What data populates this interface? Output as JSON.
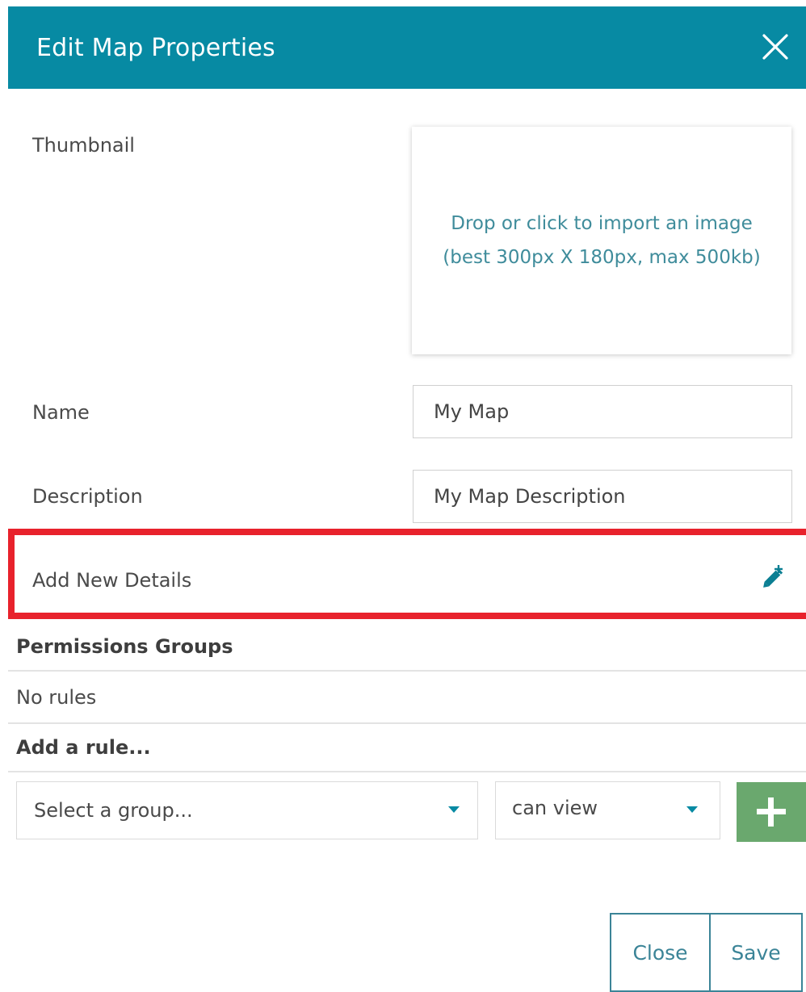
{
  "dialog": {
    "title": "Edit Map Properties"
  },
  "thumbnail": {
    "label": "Thumbnail",
    "drop_line1": "Drop or click to import an image",
    "drop_line2": "(best 300px X 180px, max 500kb)"
  },
  "name": {
    "label": "Name",
    "value": "My Map"
  },
  "description": {
    "label": "Description",
    "value": "My Map Description"
  },
  "details": {
    "label": "Add New Details"
  },
  "permissions": {
    "heading": "Permissions Groups",
    "empty_text": "No rules",
    "add_rule_label": "Add a rule...",
    "group_select_placeholder": "Select a group...",
    "permission_select_value": "can view"
  },
  "footer": {
    "close_label": "Close",
    "save_label": "Save"
  },
  "colors": {
    "header": "#078aa3",
    "highlight": "#e8222c",
    "add_button": "#6aa86e",
    "accent_text": "#3f8c9b"
  },
  "icons": {
    "close": "close-icon",
    "add_details": "edit-plus-icon",
    "dropdown": "caret-down-icon",
    "add_rule": "plus-icon"
  }
}
